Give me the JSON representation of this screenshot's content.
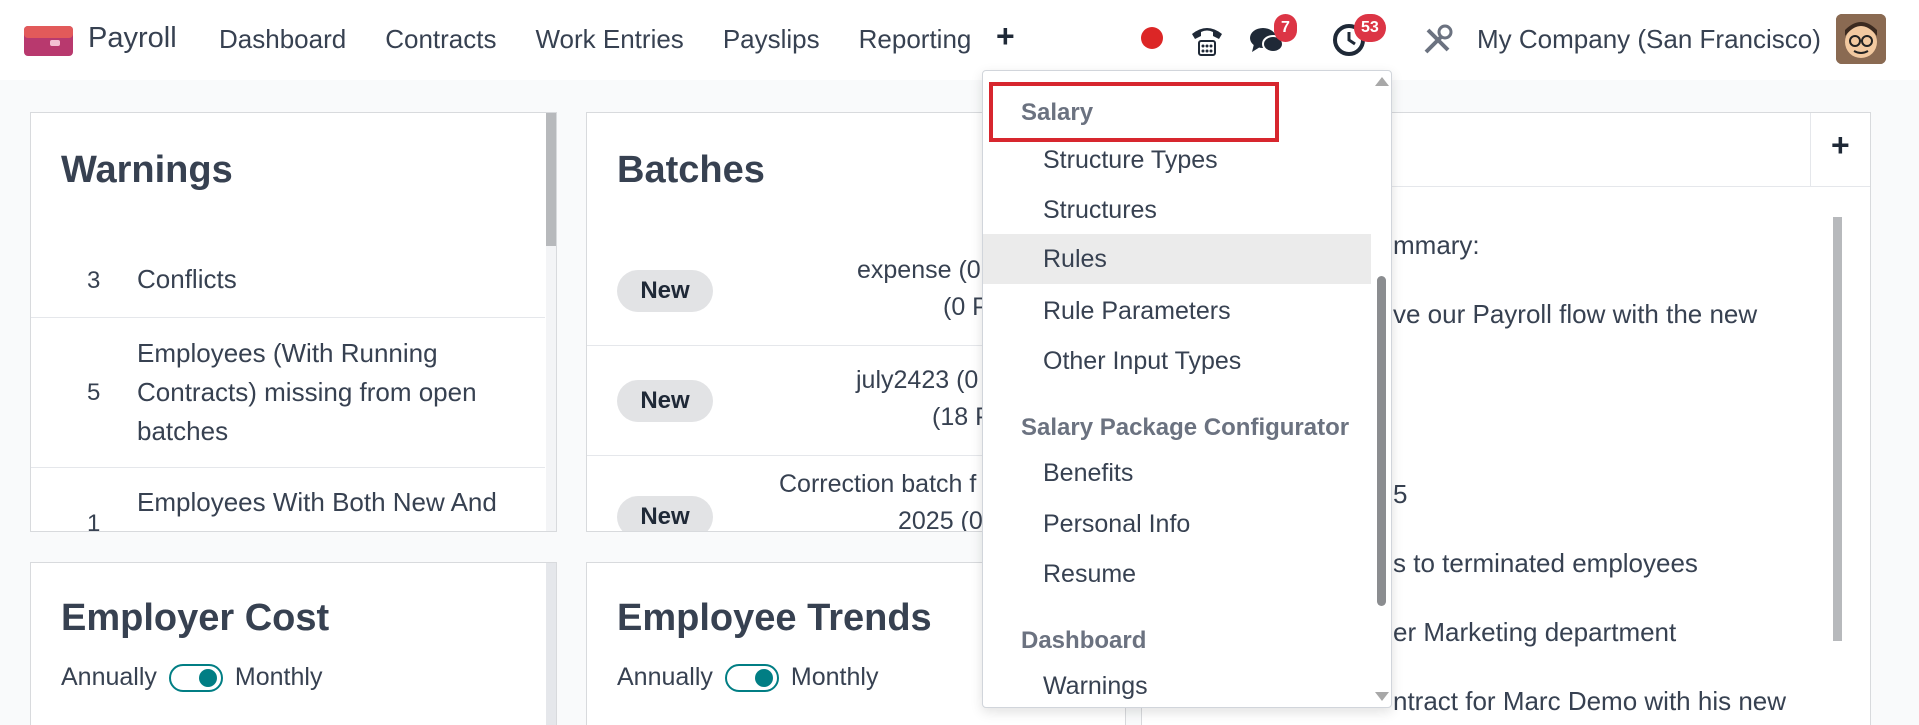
{
  "nav": {
    "app_name": "Payroll",
    "menu": [
      "Dashboard",
      "Contracts",
      "Work Entries",
      "Payslips",
      "Reporting"
    ],
    "plus": "+",
    "messages_badge": "7",
    "activities_badge": "53",
    "company": "My Company (San Francisco)"
  },
  "warnings": {
    "title": "Warnings",
    "rows": [
      {
        "count": "3",
        "label": "Conflicts"
      },
      {
        "count": "5",
        "label": "Employees (With Running Contracts) missing from open batches"
      },
      {
        "count": "1",
        "label": "Employees With Both New And Running Contracts"
      }
    ]
  },
  "batches": {
    "title": "Batches",
    "rows": [
      {
        "state": "New",
        "line1": "expense (0",
        "line2": "(0 P"
      },
      {
        "state": "New",
        "line1": "july2423 (0",
        "line2": "(18 P"
      },
      {
        "state": "New",
        "line1": "Correction batch f",
        "line2": "2025 (0"
      }
    ]
  },
  "notes": {
    "plus": "+",
    "lines": [
      "mmary:",
      "ve our Payroll flow with the new",
      "5",
      "s to terminated employees",
      "er Marketing department",
      "ntract for Marc Demo with his new"
    ]
  },
  "employer_cost": {
    "title": "Employer Cost",
    "annually": "Annually",
    "monthly": "Monthly"
  },
  "employee_trends": {
    "title": "Employee Trends",
    "annually": "Annually",
    "monthly": "Monthly"
  },
  "dropdown": {
    "sections": [
      {
        "header": "Salary",
        "items": [
          "Structure Types",
          "Structures",
          "Rules",
          "Rule Parameters",
          "Other Input Types"
        ]
      },
      {
        "header": "Salary Package Configurator",
        "items": [
          "Benefits",
          "Personal Info",
          "Resume"
        ]
      },
      {
        "header": "Dashboard",
        "items": [
          "Warnings"
        ]
      }
    ],
    "active_item": "Rules"
  },
  "colors": {
    "accent": "#017e84",
    "badge": "#dc3545",
    "highlight": "#d7262e"
  }
}
